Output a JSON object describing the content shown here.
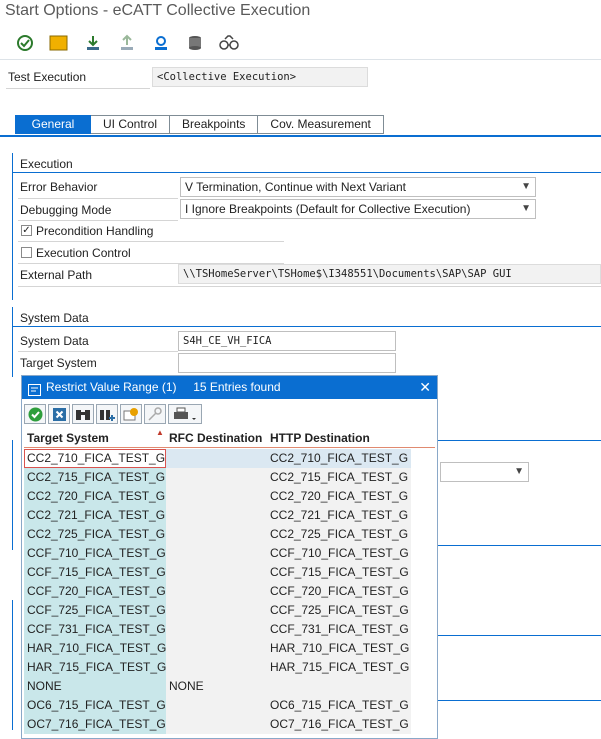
{
  "window": {
    "title": "Start Options - eCATT Collective Execution"
  },
  "toolbar": {
    "icons": [
      "execute-icon",
      "folder-icon",
      "download-icon",
      "upload-icon",
      "settings-icon",
      "database-icon",
      "glasses-icon"
    ]
  },
  "test_execution": {
    "label": "Test Execution",
    "value": "<Collective Execution>"
  },
  "tabs": [
    {
      "label": "General",
      "active": true
    },
    {
      "label": "UI Control",
      "active": false
    },
    {
      "label": "Breakpoints",
      "active": false
    },
    {
      "label": "Cov. Measurement",
      "active": false
    }
  ],
  "execution": {
    "header": "Execution",
    "error_behavior": {
      "label": "Error Behavior",
      "value": "V Termination, Continue with Next Variant"
    },
    "debugging_mode": {
      "label": "Debugging Mode",
      "value": "I Ignore Breakpoints (Default for Collective Execution)"
    },
    "precondition_handling": {
      "label": "Precondition Handling",
      "checked": true
    },
    "execution_control": {
      "label": "Execution Control",
      "checked": false
    },
    "external_path": {
      "label": "External Path",
      "value": "\\\\TSHomeServer\\TSHome$\\I348551\\Documents\\SAP\\SAP GUI"
    }
  },
  "system_data": {
    "header": "System Data",
    "system_data_field": {
      "label": "System Data",
      "value": "S4H_CE_VH_FICA"
    },
    "target_system": {
      "label": "Target System",
      "value": ""
    }
  },
  "popup": {
    "title": "Restrict Value Range (1)",
    "entries_found": "15 Entries found",
    "close": "✕",
    "toolbar_icons": [
      "check-icon",
      "cancel-icon",
      "binoculars-icon",
      "binoculars-add-icon",
      "insert-icon",
      "key-icon",
      "print-icon"
    ],
    "columns": [
      "Target System",
      "RFC Destination",
      "HTTP Destination"
    ],
    "rows": [
      {
        "target": "CC2_710_FICA_TEST_G",
        "rfc": "",
        "http": "CC2_710_FICA_TEST_G"
      },
      {
        "target": "CC2_715_FICA_TEST_G",
        "rfc": "",
        "http": "CC2_715_FICA_TEST_G"
      },
      {
        "target": "CC2_720_FICA_TEST_G",
        "rfc": "",
        "http": "CC2_720_FICA_TEST_G"
      },
      {
        "target": "CC2_721_FICA_TEST_G",
        "rfc": "",
        "http": "CC2_721_FICA_TEST_G"
      },
      {
        "target": "CC2_725_FICA_TEST_G",
        "rfc": "",
        "http": "CC2_725_FICA_TEST_G"
      },
      {
        "target": "CCF_710_FICA_TEST_G",
        "rfc": "",
        "http": "CCF_710_FICA_TEST_G"
      },
      {
        "target": "CCF_715_FICA_TEST_G",
        "rfc": "",
        "http": "CCF_715_FICA_TEST_G"
      },
      {
        "target": "CCF_720_FICA_TEST_G",
        "rfc": "",
        "http": "CCF_720_FICA_TEST_G"
      },
      {
        "target": "CCF_725_FICA_TEST_G",
        "rfc": "",
        "http": "CCF_725_FICA_TEST_G"
      },
      {
        "target": "CCF_731_FICA_TEST_G",
        "rfc": "",
        "http": "CCF_731_FICA_TEST_G"
      },
      {
        "target": "HAR_710_FICA_TEST_G",
        "rfc": "",
        "http": "HAR_710_FICA_TEST_G"
      },
      {
        "target": "HAR_715_FICA_TEST_G",
        "rfc": "",
        "http": "HAR_715_FICA_TEST_G"
      },
      {
        "target": "NONE",
        "rfc": "NONE",
        "http": ""
      },
      {
        "target": "OC6_715_FICA_TEST_G",
        "rfc": "",
        "http": "OC6_715_FICA_TEST_G"
      },
      {
        "target": "OC7_716_FICA_TEST_G",
        "rfc": "",
        "http": "OC7_716_FICA_TEST_G"
      }
    ]
  },
  "colors": {
    "accent": "#0a6ed1",
    "key_column": "#c9e7ea",
    "readonly": "#f2f2f2"
  }
}
